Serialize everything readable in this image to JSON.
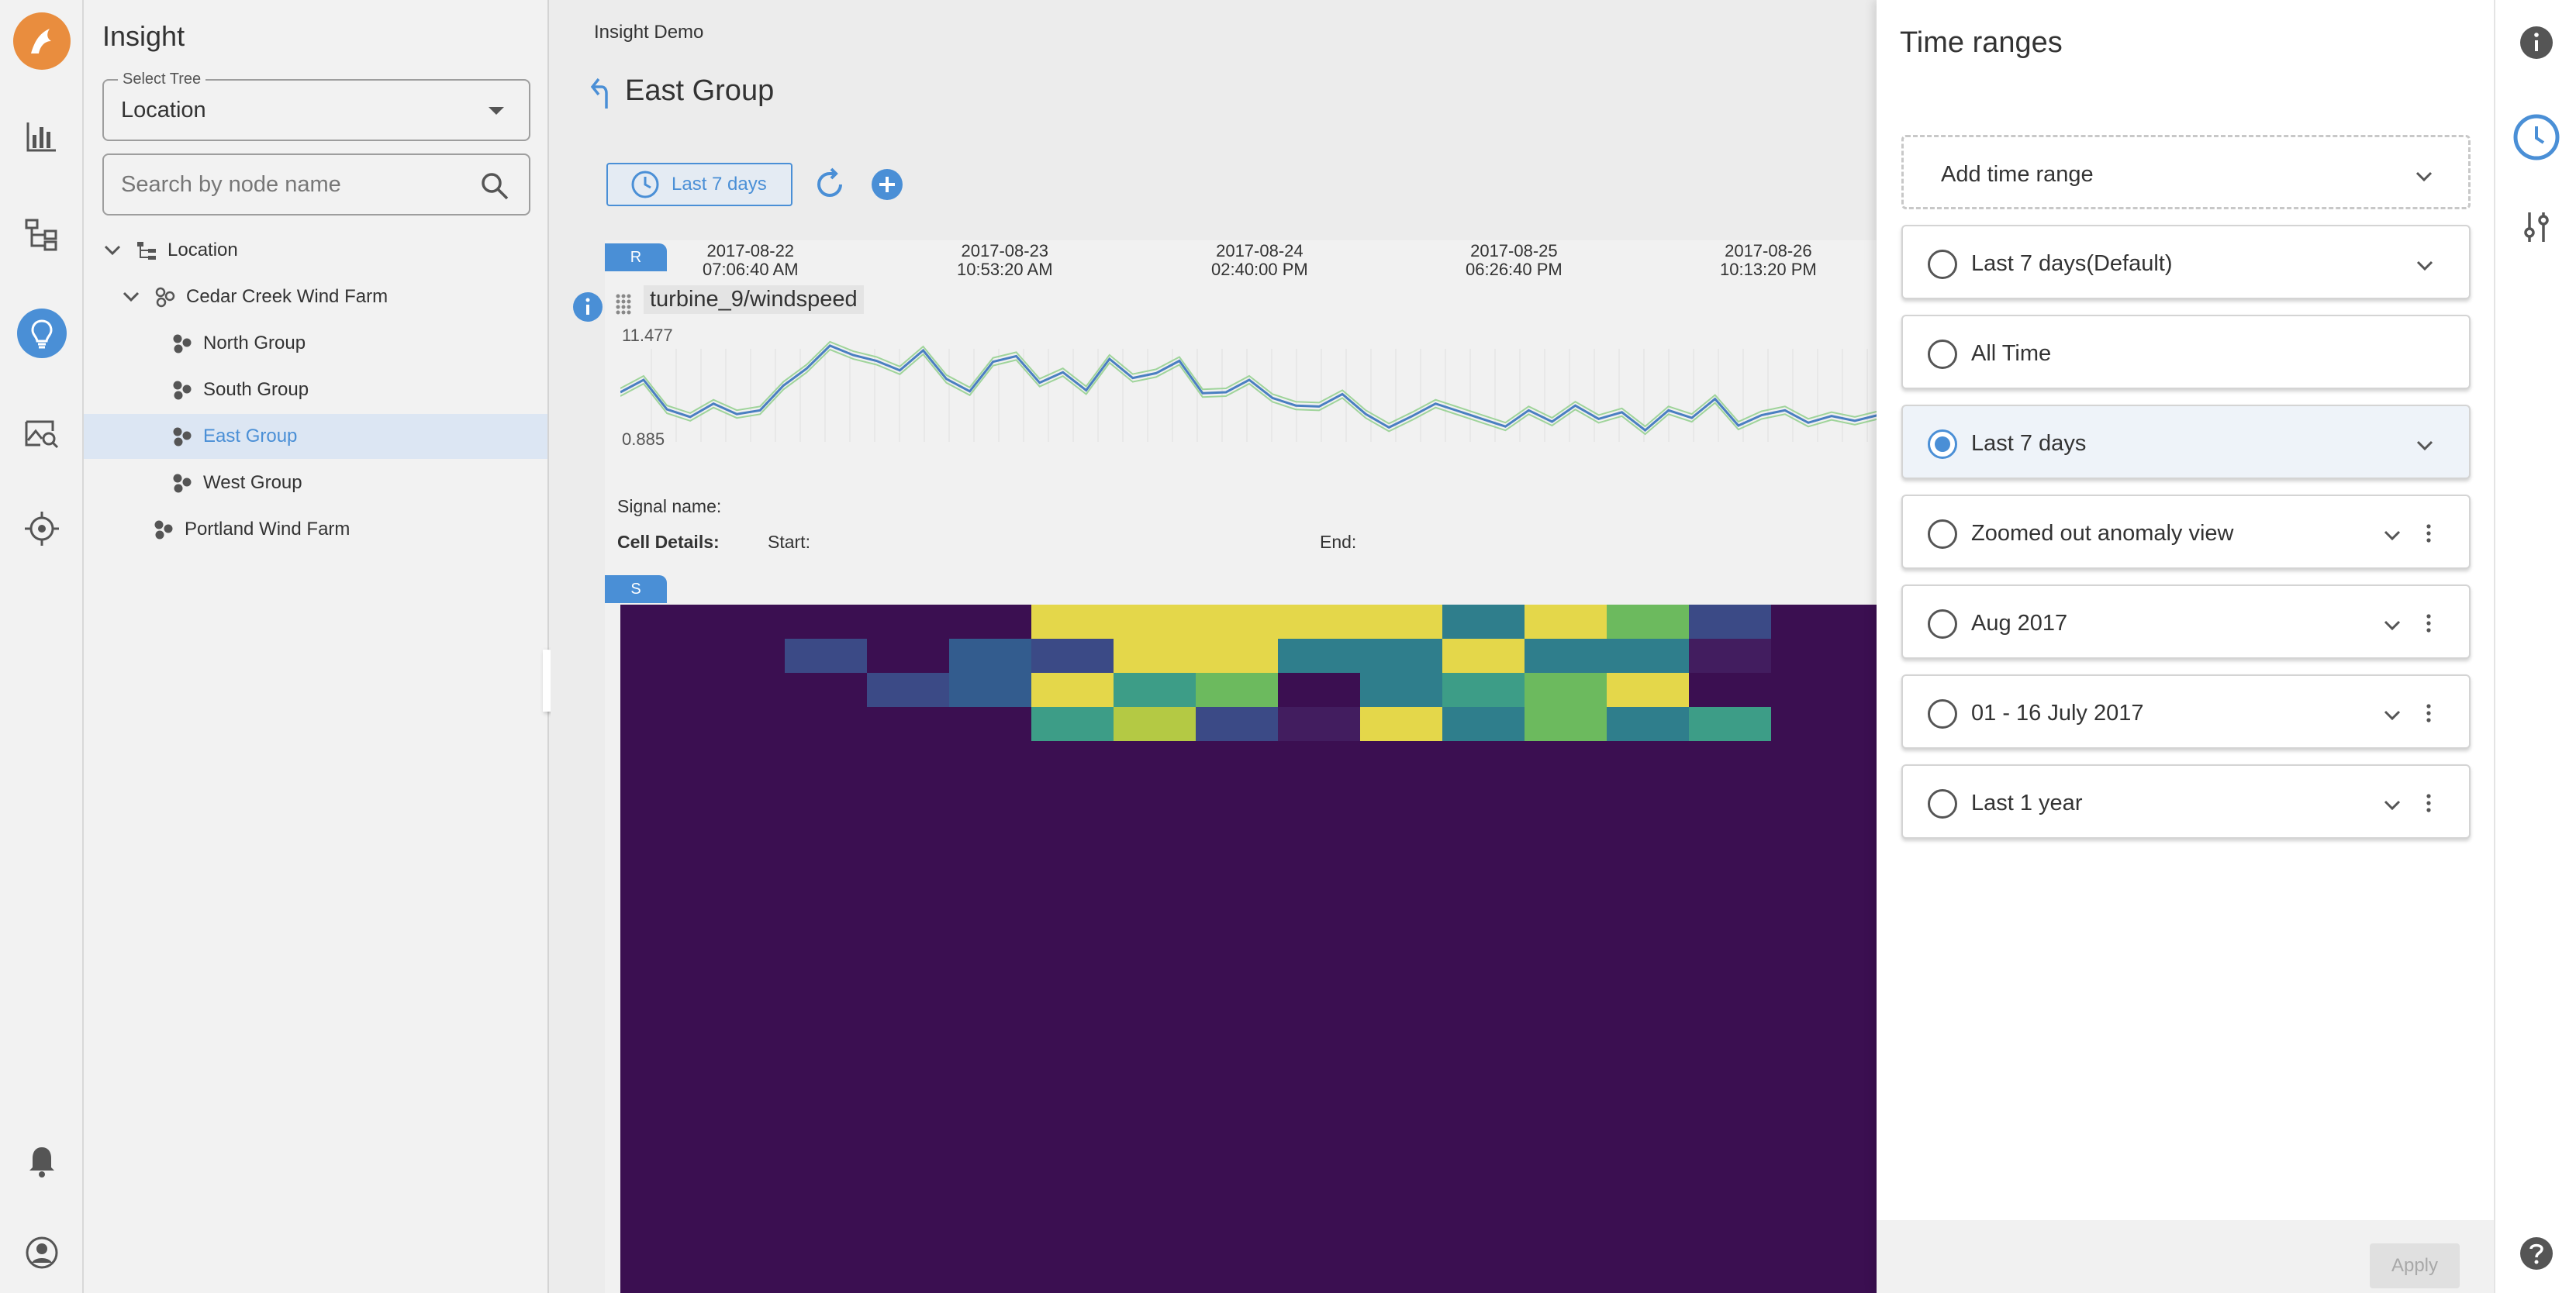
{
  "app": {
    "title": "Insight"
  },
  "rail": {
    "items": [
      {
        "icon": "bar-chart-icon"
      },
      {
        "icon": "tree-structure-icon"
      },
      {
        "icon": "lightbulb-icon",
        "active": true
      },
      {
        "icon": "image-search-icon"
      },
      {
        "icon": "crosshair-icon"
      },
      {
        "icon": "bell-icon"
      },
      {
        "icon": "account-icon"
      }
    ]
  },
  "tree_panel": {
    "select_tree": {
      "legend": "Select Tree",
      "value": "Location"
    },
    "search": {
      "placeholder": "Search by node name"
    },
    "nodes": [
      {
        "label": "Location",
        "level": 0,
        "expanded": true
      },
      {
        "label": "Cedar Creek Wind Farm",
        "level": 1,
        "expanded": true
      },
      {
        "label": "North Group",
        "level": 2
      },
      {
        "label": "South Group",
        "level": 2
      },
      {
        "label": "East Group",
        "level": 2,
        "selected": true
      },
      {
        "label": "West Group",
        "level": 2
      },
      {
        "label": "Portland Wind Farm",
        "level": 1
      }
    ]
  },
  "main": {
    "breadcrumb": "Insight Demo",
    "title": "East Group",
    "time_chip": "Last 7 days",
    "r_tab": "R",
    "s_tab": "S",
    "timestamps": [
      {
        "date": "2017-08-22",
        "time": "07:06:40 AM"
      },
      {
        "date": "2017-08-23",
        "time": "10:53:20 AM"
      },
      {
        "date": "2017-08-24",
        "time": "02:40:00 PM"
      },
      {
        "date": "2017-08-25",
        "time": "06:26:40 PM"
      },
      {
        "date": "2017-08-26",
        "time": "10:13:20 PM"
      }
    ],
    "series_name": "turbine_9/windspeed",
    "y_max": "11.477",
    "y_min": "0.885",
    "signal_name_label": "Signal name:",
    "cell_details_label": "Cell Details:",
    "start_label": "Start:",
    "end_label": "End:"
  },
  "chart_data": {
    "type": "line",
    "ylim": [
      0.885,
      11.477
    ],
    "series": [
      {
        "color": "#4a7fc1",
        "values": [
          6.1,
          7.4,
          4.3,
          3.5,
          4.9,
          3.8,
          4.2,
          6.8,
          8.6,
          11.0,
          10.0,
          9.4,
          8.4,
          10.5,
          7.5,
          6.2,
          9.3,
          9.9,
          7.1,
          8.2,
          6.3,
          9.6,
          7.6,
          8.1,
          9.4,
          6.0,
          6.1,
          7.4,
          5.5,
          4.7,
          4.6,
          5.9,
          3.8,
          2.4,
          3.6,
          4.9,
          4.1,
          3.3,
          2.5,
          4.2,
          3.0,
          4.7,
          3.3,
          4.0,
          2.1,
          4.2,
          3.4,
          5.4,
          2.6,
          3.7,
          4.2,
          2.9,
          3.6,
          3.1,
          3.7
        ]
      }
    ]
  },
  "heatmap": {
    "colors": {
      "background": "#3b0f51",
      "yellow": "#e4d74a",
      "teal": "#2f7e8c",
      "green": "#6cba5e",
      "lime": "#b4c944",
      "navy": "#3b4a86",
      "blue": "#335c8e",
      "seafoam": "#3d9d87",
      "darkpurple": "#421d5f"
    },
    "rows": [
      [
        "",
        "",
        "",
        "",
        "",
        "yellow",
        "yellow",
        "yellow",
        "yellow",
        "yellow",
        "teal",
        "yellow",
        "green",
        "navy"
      ],
      [
        "",
        "",
        "navy",
        "",
        "blue",
        "navy",
        "yellow",
        "yellow",
        "teal",
        "teal",
        "yellow",
        "teal",
        "teal",
        "darkpurple"
      ],
      [
        "",
        "",
        "",
        "navy",
        "blue",
        "yellow",
        "seafoam",
        "green",
        "",
        "teal",
        "seafoam",
        "green",
        "yellow",
        ""
      ],
      [
        "",
        "",
        "",
        "",
        "",
        "seafoam",
        "lime",
        "navy",
        "darkpurple",
        "yellow",
        "teal",
        "green",
        "teal",
        "seafoam"
      ]
    ]
  },
  "time_ranges": {
    "title": "Time ranges",
    "add_label": "Add time range",
    "items": [
      {
        "label": "Last 7 days(Default)",
        "chevron": true,
        "kebab": false,
        "selected": false
      },
      {
        "label": "All Time",
        "chevron": false,
        "kebab": false,
        "selected": false
      },
      {
        "label": "Last 7 days",
        "chevron": true,
        "kebab": false,
        "selected": true
      },
      {
        "label": "Zoomed out anomaly view",
        "chevron": true,
        "kebab": true,
        "selected": false
      },
      {
        "label": "Aug 2017",
        "chevron": true,
        "kebab": true,
        "selected": false
      },
      {
        "label": "01 - 16 July 2017",
        "chevron": true,
        "kebab": true,
        "selected": false
      },
      {
        "label": "Last 1 year",
        "chevron": true,
        "kebab": true,
        "selected": false
      }
    ],
    "apply_label": "Apply"
  },
  "right_rail": {
    "items": [
      {
        "icon": "info-icon"
      },
      {
        "icon": "clock-icon",
        "active": true
      },
      {
        "icon": "sliders-icon"
      },
      {
        "icon": "help-icon"
      }
    ]
  }
}
